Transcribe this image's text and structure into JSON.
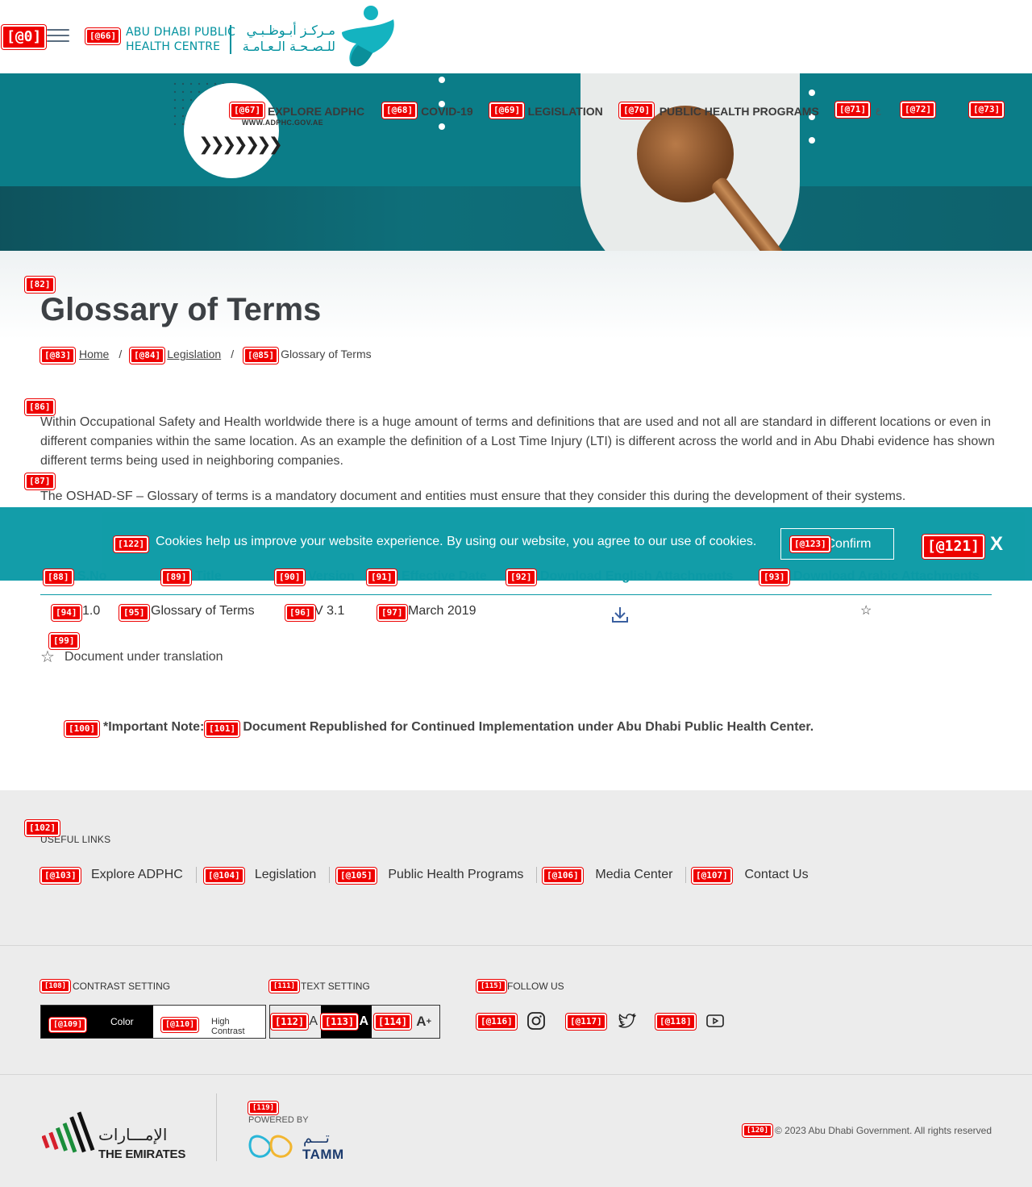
{
  "header": {
    "logo_en_line1": "ABU DHABI PUBLIC",
    "logo_en_line2": "HEALTH CENTRE",
    "logo_ar_line1": "مـركـز أبـوظـبـي",
    "logo_ar_line2": "للـصـحـة الـعـامـة",
    "nav": [
      "EXPLORE ADPHC",
      "COVID-19",
      "LEGISLATION",
      "PUBLIC HEALTH PROGRAMS"
    ],
    "hero_url": "WWW.ADPHC.GOV.AE"
  },
  "page": {
    "title": "Glossary of Terms",
    "breadcrumb": [
      "Home",
      "Legislation",
      "Glossary of Terms"
    ],
    "para1": "Within Occupational Safety and Health worldwide there is a huge amount of terms and definitions that are used and not all are standard in different locations or even in different companies within the same location. As an example the definition of a Lost Time Injury (LTI) is different across the world and in Abu Dhabi evidence has shown different terms being used in neighboring companies.",
    "para2": "The OSHAD-SF – Glossary of terms is a mandatory document and entities must ensure that they consider this during the development of their systems."
  },
  "cookie": {
    "text": "Cookies help us improve your website experience. By using our website, you agree to our use of cookies.",
    "confirm": "Confirm",
    "close": "X"
  },
  "table": {
    "headers": [
      "S.No",
      "Title",
      "Version",
      "Effective Date",
      "Download English Attachments",
      "Download Arabic Attachments"
    ],
    "rows": [
      {
        "sno": "1.0",
        "title": "Glossary of Terms",
        "version": "V 3.1",
        "date": "March 2019"
      }
    ],
    "legend": "Document under translation"
  },
  "note": {
    "label": "*Important Note:",
    "text": "Document Republished for Continued Implementation under Abu Dhabi Public Health Center."
  },
  "footer": {
    "useful_title": "USEFUL LINKS",
    "links": [
      "Explore ADPHC",
      "Legislation",
      "Public Health Programs",
      "Media Center",
      "Contact Us"
    ],
    "contrast_title": "CONTRAST SETTING",
    "contrast_color": "Color",
    "contrast_high_1": "High",
    "contrast_high_2": "Contrast",
    "text_title": "TEXT SETTING",
    "text_small": "A",
    "text_normal": "A",
    "text_large": "A",
    "follow_title": "FOLLOW US",
    "emirates_ar": "الإمـــارات",
    "emirates_en": "THE EMIRATES",
    "powered_by": "POWERED BY",
    "tamm_ar": "تـــم",
    "tamm_en": "TAMM",
    "copyright": "© 2023 Abu Dhabi Government. All rights reserved"
  },
  "tags": {
    "t0": "[@0]",
    "t66": "[@66]",
    "t67": "[@67]",
    "t68": "[@68]",
    "t69": "[@69]",
    "t70": "[@70]",
    "t71": "[@71]",
    "t72": "[@72]",
    "t73": "[@73]",
    "t82": "[82]",
    "t83": "[@83]",
    "t84": "[@84]",
    "t85": "[@85]",
    "t86": "[86]",
    "t87": "[87]",
    "t88": "[88]",
    "t89": "[89]",
    "t90": "[90]",
    "t91": "[91]",
    "t92": "[92]",
    "t93": "[93]",
    "t94": "[94]",
    "t95": "[95]",
    "t96": "[96]",
    "t97": "[97]",
    "t99": "[99]",
    "t100": "[100]",
    "t101": "[101]",
    "t102": "[102]",
    "t103": "[@103]",
    "t104": "[@104]",
    "t105": "[@105]",
    "t106": "[@106]",
    "t107": "[@107]",
    "t108": "[108]",
    "t109": "[@109]",
    "t110": "[@110]",
    "t111": "[111]",
    "t112": "[112]",
    "t113": "[113]",
    "t114": "[114]",
    "t115": "[115]",
    "t116": "[@116]",
    "t117": "[@117]",
    "t118": "[@118]",
    "t119": "[119]",
    "t120": "[120]",
    "t121": "[@121]",
    "t122": "[122]",
    "t123": "[@123]"
  },
  "colors": {
    "teal": "#0b9aa6",
    "dark_teal": "#0b7d88",
    "tag_red": "#e00"
  }
}
